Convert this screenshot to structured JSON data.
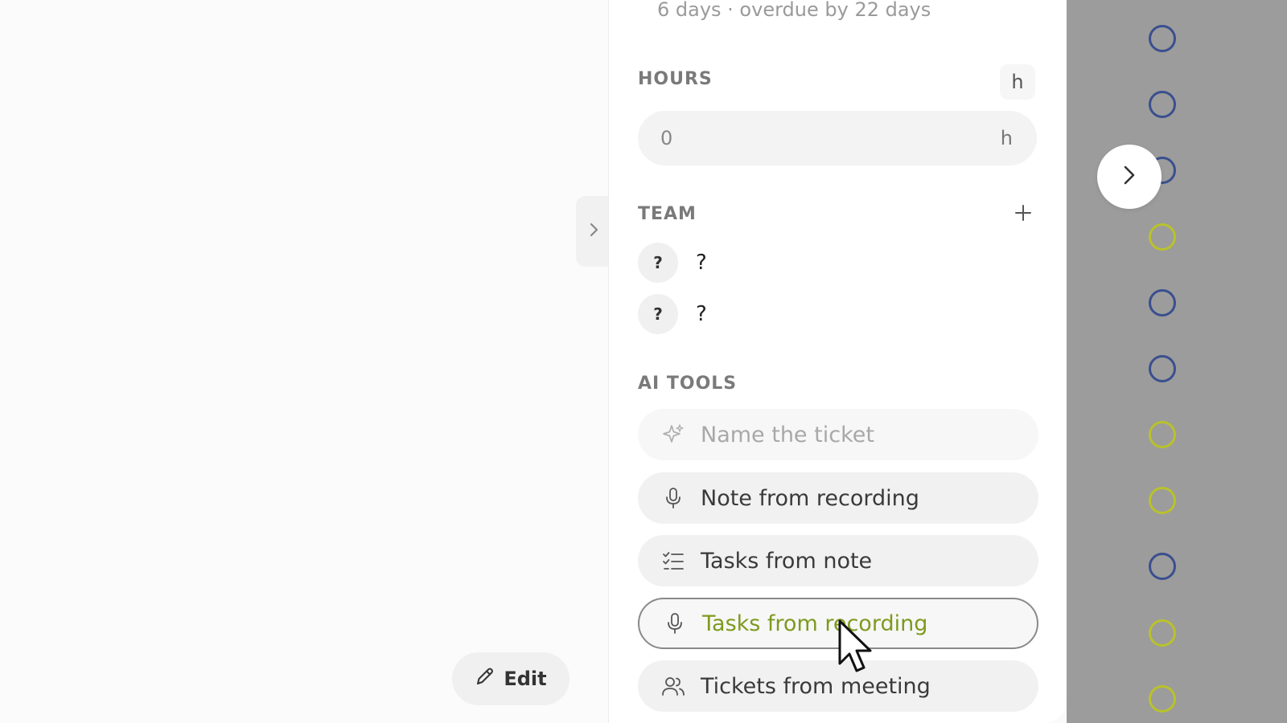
{
  "due": {
    "text": "6 days · overdue by 22 days"
  },
  "hours": {
    "label": "HOURS",
    "unit_chip": "h",
    "value": "0",
    "unit": "h"
  },
  "team": {
    "label": "TEAM",
    "members": [
      {
        "initials": "?",
        "name": "?"
      },
      {
        "initials": "?",
        "name": "?"
      }
    ]
  },
  "ai_tools": {
    "label": "AI TOOLS",
    "items": [
      {
        "label": "Name the ticket",
        "icon": "sparkle-icon",
        "state": "disabled"
      },
      {
        "label": "Note from recording",
        "icon": "microphone-icon",
        "state": "normal"
      },
      {
        "label": "Tasks from note",
        "icon": "checklist-icon",
        "state": "normal"
      },
      {
        "label": "Tasks from recording",
        "icon": "microphone-icon",
        "state": "active"
      },
      {
        "label": "Tickets from meeting",
        "icon": "users-icon",
        "state": "normal"
      }
    ]
  },
  "edit_button": {
    "label": "Edit",
    "icon": "pencil-icon"
  },
  "status_rings": [
    "blue",
    "blue",
    "blue",
    "yellow",
    "blue",
    "blue",
    "yellow",
    "yellow",
    "blue",
    "yellow",
    "yellow"
  ],
  "colors": {
    "accent_green": "#7d9a1e",
    "ring_blue": "#3a4f8f",
    "ring_yellow": "#b9c22b",
    "overlay_gray": "#9c9c9c"
  }
}
